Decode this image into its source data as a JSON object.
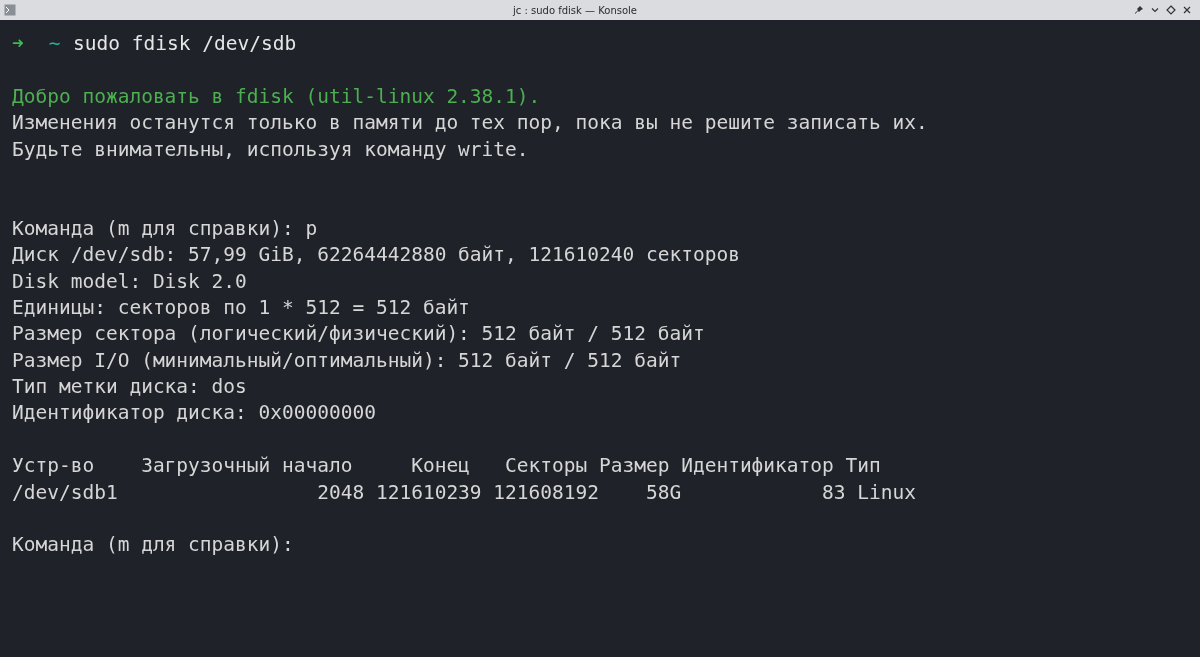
{
  "window": {
    "title": "jc : sudo fdisk — Konsole"
  },
  "terminal": {
    "lines": [
      {
        "kind": "prompt",
        "arrow": "➜",
        "cwd": "~",
        "command": "sudo fdisk /dev/sdb"
      },
      {
        "kind": "gap"
      },
      {
        "kind": "success",
        "text": "Добро пожаловать в fdisk (util-linux 2.38.1)."
      },
      {
        "kind": "output",
        "text": "Изменения останутся только в памяти до тех пор, пока вы не решите записать их."
      },
      {
        "kind": "output",
        "text": "Будьте внимательны, используя команду write."
      },
      {
        "kind": "gap"
      },
      {
        "kind": "gap"
      },
      {
        "kind": "output",
        "text": "Команда (m для справки): p"
      },
      {
        "kind": "output",
        "text": "Диск /dev/sdb: 57,99 GiB, 62264442880 байт, 121610240 секторов"
      },
      {
        "kind": "output",
        "text": "Disk model: Disk 2.0"
      },
      {
        "kind": "output",
        "text": "Единицы: секторов по 1 * 512 = 512 байт"
      },
      {
        "kind": "output",
        "text": "Размер сектора (логический/физический): 512 байт / 512 байт"
      },
      {
        "kind": "output",
        "text": "Размер I/O (минимальный/оптимальный): 512 байт / 512 байт"
      },
      {
        "kind": "output",
        "text": "Тип метки диска: dos"
      },
      {
        "kind": "output",
        "text": "Идентификатор диска: 0x00000000"
      },
      {
        "kind": "gap"
      },
      {
        "kind": "output",
        "text": "Устр-во    Загрузочный начало     Конец   Секторы Размер Идентификатор Тип"
      },
      {
        "kind": "output",
        "text": "/dev/sdb1                 2048 121610239 121608192    58G            83 Linux"
      },
      {
        "kind": "gap"
      },
      {
        "kind": "output",
        "text": "Команда (m для справки):"
      }
    ]
  }
}
